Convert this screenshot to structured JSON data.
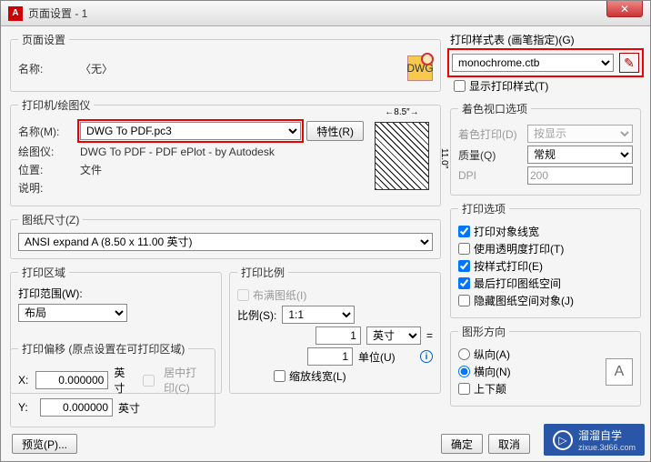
{
  "window": {
    "title": "页面设置 - 1",
    "close": "✕"
  },
  "page_setup": {
    "legend": "页面设置",
    "name_label": "名称:",
    "name_value": "〈无〉",
    "dwg": "DWG"
  },
  "printer": {
    "legend": "打印机/绘图仪",
    "name_label": "名称(M):",
    "name_value": "DWG To PDF.pc3",
    "props_btn": "特性(R)",
    "plotter_label": "绘图仪:",
    "plotter_value": "DWG To PDF - PDF ePlot - by Autodesk",
    "location_label": "位置:",
    "location_value": "文件",
    "desc_label": "说明:",
    "preview_w": "←8.5″→",
    "preview_h": "11.0″"
  },
  "paper": {
    "legend": "图纸尺寸(Z)",
    "value": "ANSI expand A (8.50 x 11.00 英寸)"
  },
  "area": {
    "legend": "打印区域",
    "range_label": "打印范围(W):",
    "range_value": "布局"
  },
  "scale": {
    "legend": "打印比例",
    "fit_label": "布满图纸(I)",
    "ratio_label": "比例(S):",
    "ratio_value": "1:1",
    "unit_count": "1",
    "unit_sel": "英寸",
    "equals": "=",
    "drawing_unit": "1",
    "drawing_unit_label": "单位(U)",
    "scale_lw": "缩放线宽(L)"
  },
  "offset": {
    "legend": "打印偏移 (原点设置在可打印区域)",
    "x_label": "X:",
    "y_label": "Y:",
    "x_value": "0.000000",
    "y_value": "0.000000",
    "unit": "英寸",
    "center": "居中打印(C)"
  },
  "style": {
    "legend": "打印样式表 (画笔指定)(G)",
    "value": "monochrome.ctb",
    "show": "显示打印样式(T)"
  },
  "shade": {
    "legend": "着色视口选项",
    "shade_label": "着色打印(D)",
    "shade_value": "按显示",
    "quality_label": "质量(Q)",
    "quality_value": "常规",
    "dpi_label": "DPI",
    "dpi_value": "200"
  },
  "options": {
    "legend": "打印选项",
    "o1": "打印对象线宽",
    "o2": "使用透明度打印(T)",
    "o3": "按样式打印(E)",
    "o4": "最后打印图纸空间",
    "o5": "隐藏图纸空间对象(J)"
  },
  "orient": {
    "legend": "图形方向",
    "portrait": "纵向(A)",
    "landscape": "横向(N)",
    "upside": "上下颠"
  },
  "footer": {
    "preview": "预览(P)...",
    "ok": "确定",
    "cancel": "取消"
  },
  "watermark": {
    "text": "溜溜自学",
    "sub": "zixue.3d66.com",
    "play": "▷"
  }
}
